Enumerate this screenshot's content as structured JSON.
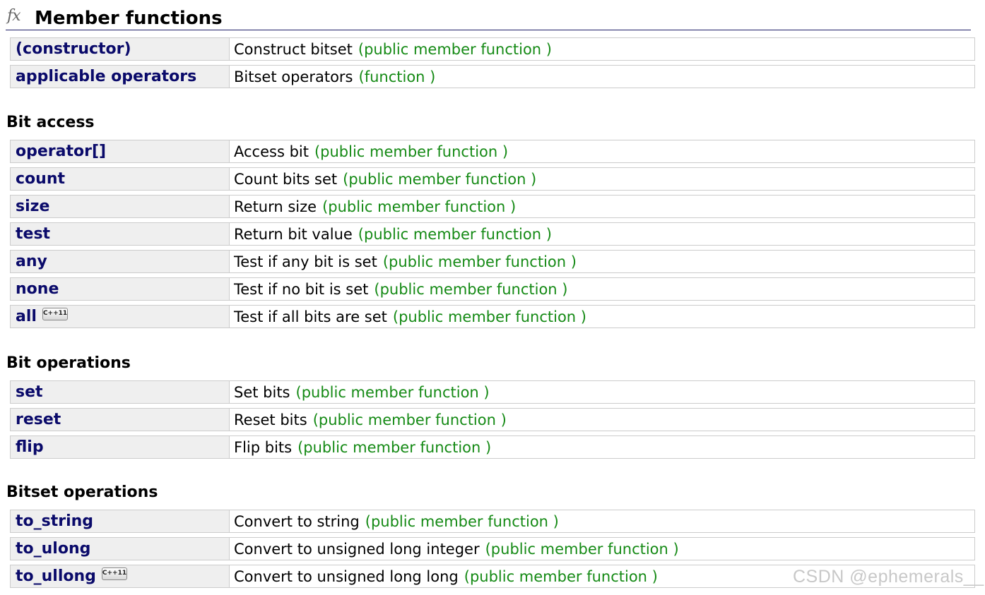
{
  "header": {
    "icon": "fx-icon",
    "title": "Member functions"
  },
  "sections": [
    {
      "heading": "",
      "rows": [
        {
          "name": "(constructor)",
          "desc": "Construct bitset",
          "kind": "(public member function )"
        },
        {
          "name": "applicable operators",
          "desc": "Bitset operators",
          "kind": "(function )"
        }
      ]
    },
    {
      "heading": "Bit access",
      "rows": [
        {
          "name": "operator[]",
          "desc": "Access bit",
          "kind": "(public member function )"
        },
        {
          "name": "count",
          "desc": "Count bits set",
          "kind": "(public member function )"
        },
        {
          "name": "size",
          "desc": "Return size",
          "kind": "(public member function )"
        },
        {
          "name": "test",
          "desc": "Return bit value",
          "kind": "(public member function )"
        },
        {
          "name": "any",
          "desc": "Test if any bit is set",
          "kind": "(public member function )"
        },
        {
          "name": "none",
          "desc": "Test if no bit is set",
          "kind": "(public member function )"
        },
        {
          "name": "all",
          "badge": "C++11",
          "desc": "Test if all bits are set",
          "kind": "(public member function )"
        }
      ]
    },
    {
      "heading": "Bit operations",
      "rows": [
        {
          "name": "set",
          "desc": "Set bits",
          "kind": "(public member function )"
        },
        {
          "name": "reset",
          "desc": "Reset bits",
          "kind": "(public member function )"
        },
        {
          "name": "flip",
          "desc": "Flip bits",
          "kind": "(public member function )"
        }
      ]
    },
    {
      "heading": "Bitset operations",
      "rows": [
        {
          "name": "to_string",
          "desc": "Convert to string",
          "kind": "(public member function )"
        },
        {
          "name": "to_ulong",
          "desc": "Convert to unsigned long integer",
          "kind": "(public member function )"
        },
        {
          "name": "to_ullong",
          "badge": "C++11",
          "desc": "Convert to unsigned long long",
          "kind": "(public member function )"
        }
      ]
    }
  ],
  "watermark": "CSDN @ephemerals__",
  "colors": {
    "name_text": "#0a0a6a",
    "kind_text": "#158a15",
    "name_cell_bg": "#efefef",
    "border": "#cccccc"
  }
}
